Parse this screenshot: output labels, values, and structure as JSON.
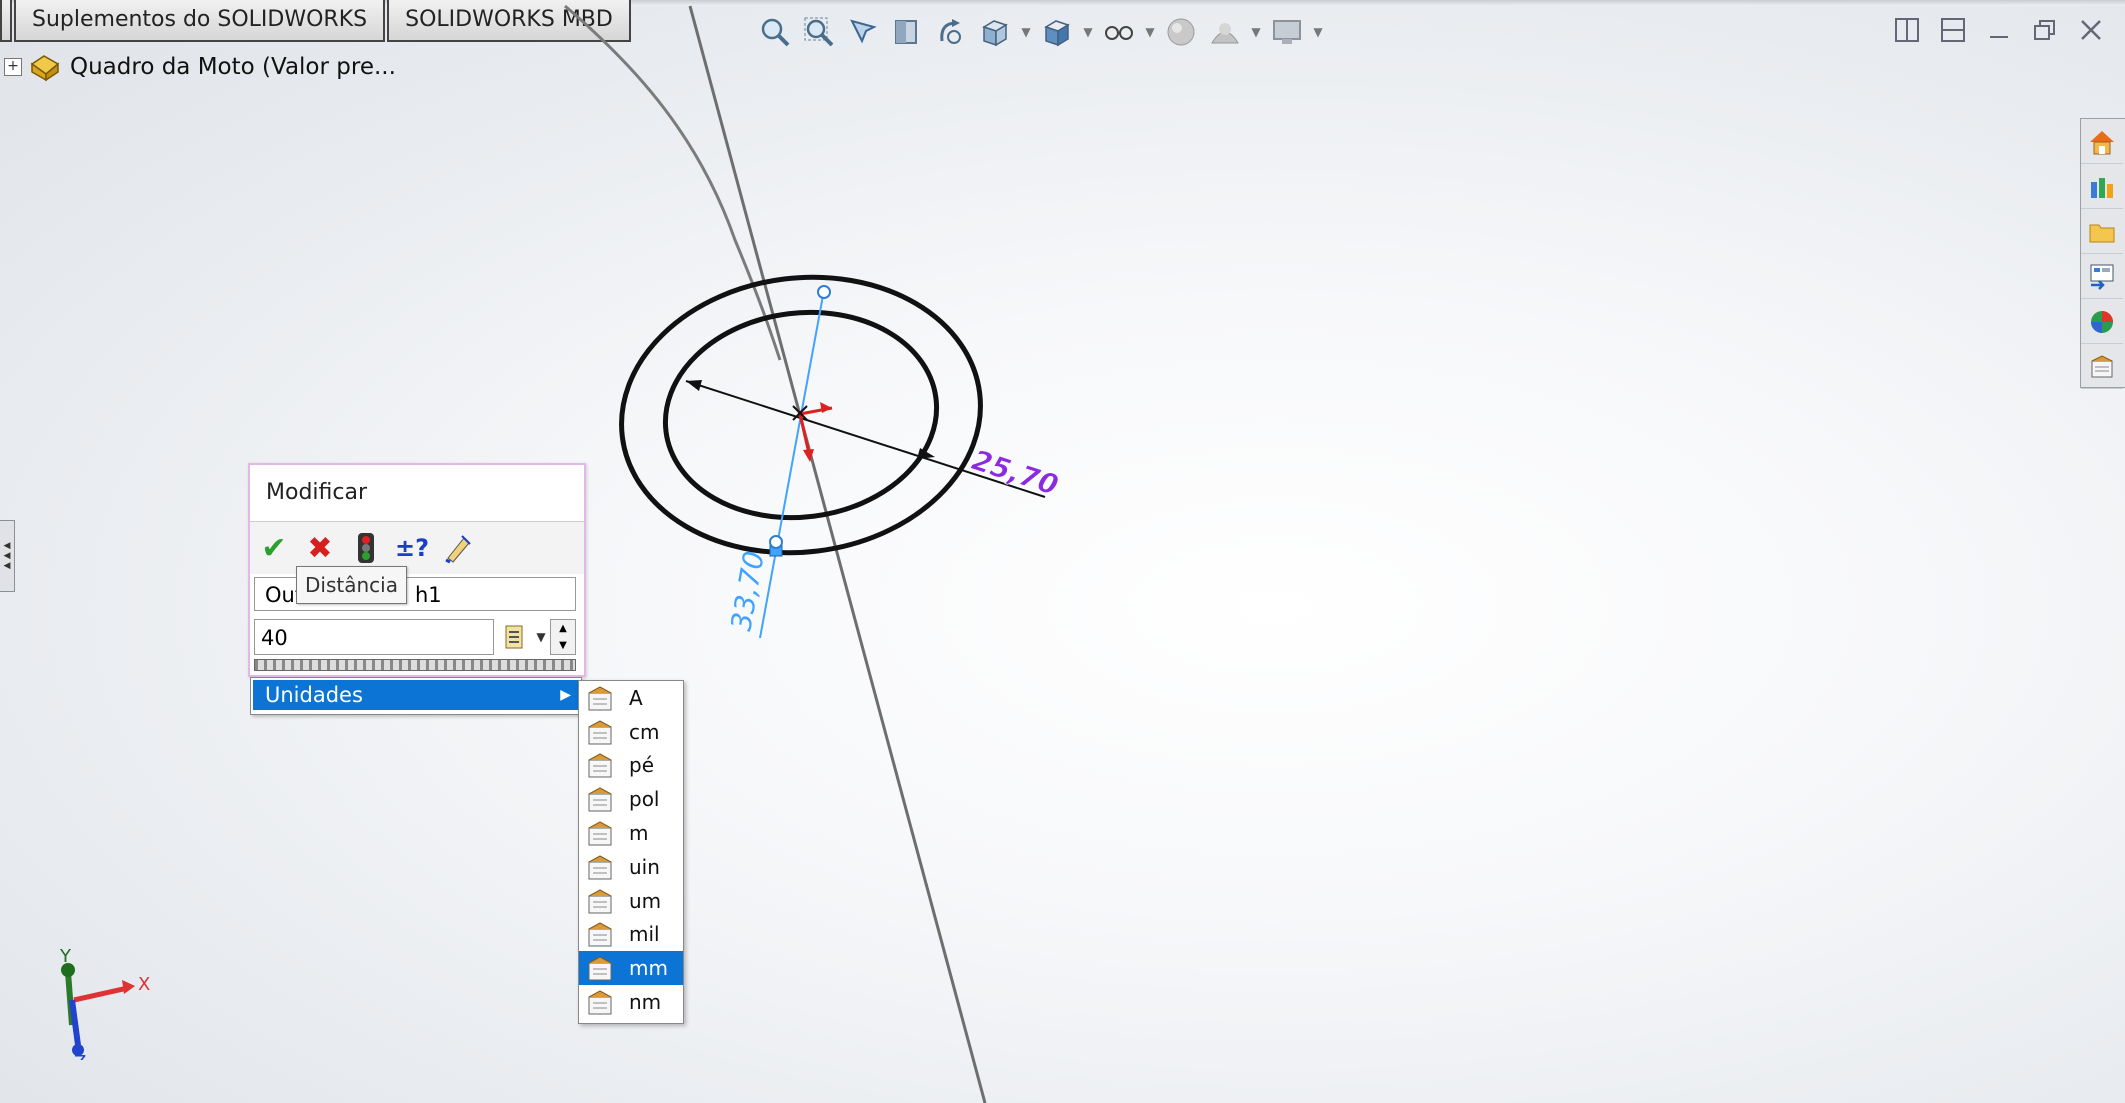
{
  "tabs": [
    {
      "label": ""
    },
    {
      "label": "Suplementos do SOLIDWORKS"
    },
    {
      "label": "SOLIDWORKS MBD"
    }
  ],
  "feature_tree": {
    "expander": "+",
    "root_label": "Quadro da Moto  (Valor pre..."
  },
  "heads_up_toolbar": {
    "icons": [
      "zoom-to-fit-icon",
      "zoom-to-area-icon",
      "previous-view-icon",
      "section-view-icon",
      "dynamic-annotation-icon",
      "view-orientation-icon",
      "display-style-icon",
      "hide-show-items-icon",
      "edit-appearance-icon",
      "apply-scene-icon",
      "view-settings-icon"
    ]
  },
  "window_controls": [
    "tile-horizontal-icon",
    "tile-vertical-icon",
    "minimize-icon",
    "restore-icon",
    "close-icon"
  ],
  "task_pane": [
    "solidworks-resources-icon",
    "design-library-icon",
    "file-explorer-icon",
    "view-palette-icon",
    "appearances-icon",
    "custom-properties-icon"
  ],
  "sketch": {
    "dimension_1": "25,70",
    "dimension_2": "33,70"
  },
  "modify_dialog": {
    "title": "Modificar",
    "name_left": "Out",
    "name_right": "h1",
    "value": "40",
    "tooltip": "Distância"
  },
  "context_menu": {
    "item": "Unidades",
    "arrow": "▶"
  },
  "units_submenu": {
    "items": [
      "A",
      "cm",
      "pé",
      "pol",
      "m",
      "uin",
      "um",
      "mil",
      "mm",
      "nm"
    ],
    "selected": "mm"
  },
  "triad": {
    "x": "X",
    "y": "Y",
    "z": "Z"
  },
  "colors": {
    "selection_blue": "#0b74d4",
    "dimension_purple": "#8a2be2",
    "dimension_blue": "#3fa3ff",
    "dialog_border": "#e3b7e8"
  }
}
